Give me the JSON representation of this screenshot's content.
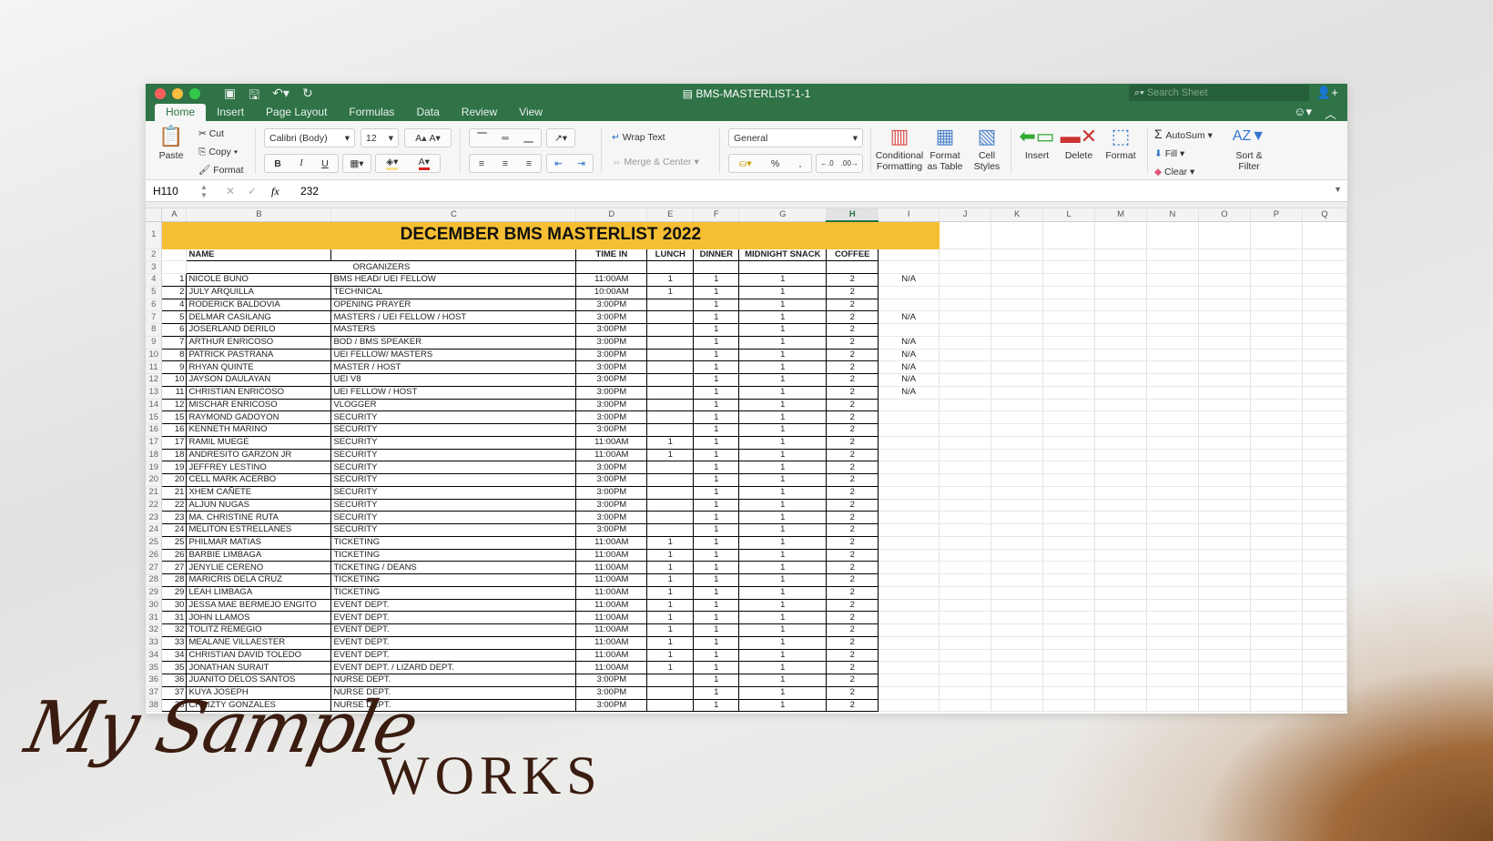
{
  "window": {
    "title": "BMS-MASTERLIST-1-1",
    "search_placeholder": "Search Sheet"
  },
  "tabs": [
    "Home",
    "Insert",
    "Page Layout",
    "Formulas",
    "Data",
    "Review",
    "View"
  ],
  "ribbon": {
    "paste": "Paste",
    "cut": "Cut",
    "copy": "Copy",
    "format_painter": "Format",
    "font_name": "Calibri (Body)",
    "font_size": "12",
    "bold": "B",
    "italic": "I",
    "underline": "U",
    "wrap_text": "Wrap Text",
    "merge_center": "Merge & Center",
    "number_format": "General",
    "percent": "%",
    "conditional_formatting": "Conditional Formatting",
    "format_as_table": "Format as Table",
    "cell_styles": "Cell Styles",
    "insert": "Insert",
    "delete": "Delete",
    "format": "Format",
    "autosum": "AutoSum",
    "fill": "Fill",
    "clear": "Clear",
    "sort_filter": "Sort & Filter"
  },
  "formula_bar": {
    "cell_ref": "H110",
    "fx": "fx",
    "value": "232"
  },
  "columns": [
    "A",
    "B",
    "C",
    "D",
    "E",
    "F",
    "G",
    "H",
    "I",
    "J",
    "K",
    "L",
    "M",
    "N",
    "O",
    "P",
    "Q"
  ],
  "selected_column": "H",
  "sheet": {
    "title": "DECEMBER BMS MASTERLIST 2022",
    "headers": {
      "name": "NAME",
      "time_in": "TIME IN",
      "lunch": "LUNCH",
      "dinner": "DINNER",
      "snack": "MIDNIGHT SNACK",
      "coffee": "COFFEE"
    },
    "section": "ORGANIZERS",
    "rows": [
      [
        "1",
        "NICOLE BUNO",
        "BMS HEAD/ UEI FELLOW",
        "11:00AM",
        "1",
        "1",
        "1",
        "2",
        "N/A"
      ],
      [
        "2",
        "JULY ARQUILLA",
        "TECHNICAL",
        "10:00AM",
        "1",
        "1",
        "1",
        "2",
        ""
      ],
      [
        "4",
        "RODERICK BALDOVIA",
        "OPENING PRAYER",
        "3:00PM",
        "",
        "1",
        "1",
        "2",
        ""
      ],
      [
        "5",
        "DELMAR CASILANG",
        "MASTERS / UEI FELLOW / HOST",
        "3:00PM",
        "",
        "1",
        "1",
        "2",
        "N/A"
      ],
      [
        "6",
        "JOSERLAND DERILO",
        "MASTERS",
        "3:00PM",
        "",
        "1",
        "1",
        "2",
        ""
      ],
      [
        "7",
        "ARTHUR ENRICOSO",
        "BOD / BMS SPEAKER",
        "3:00PM",
        "",
        "1",
        "1",
        "2",
        "N/A"
      ],
      [
        "8",
        "PATRICK PASTRANA",
        "UEI FELLOW/ MASTERS",
        "3:00PM",
        "",
        "1",
        "1",
        "2",
        "N/A"
      ],
      [
        "9",
        "RHYAN QUINTE",
        "MASTER / HOST",
        "3:00PM",
        "",
        "1",
        "1",
        "2",
        "N/A"
      ],
      [
        "10",
        "JAYSON DAULAYAN",
        "UEI V8",
        "3:00PM",
        "",
        "1",
        "1",
        "2",
        "N/A"
      ],
      [
        "11",
        "CHRISTIAN ENRICOSO",
        "UEI FELLOW / HOST",
        "3:00PM",
        "",
        "1",
        "1",
        "2",
        "N/A"
      ],
      [
        "12",
        "MISCHAR ENRICOSO",
        "VLOGGER",
        "3:00PM",
        "",
        "1",
        "1",
        "2",
        ""
      ],
      [
        "15",
        "RAYMOND GADOYON",
        "SECURITY",
        "3:00PM",
        "",
        "1",
        "1",
        "2",
        ""
      ],
      [
        "16",
        "KENNETH MARINO",
        "SECURITY",
        "3:00PM",
        "",
        "1",
        "1",
        "2",
        ""
      ],
      [
        "17",
        "RAMIL MUEGE",
        "SECURITY",
        "11:00AM",
        "1",
        "1",
        "1",
        "2",
        ""
      ],
      [
        "18",
        "ANDRESITO GARZON JR",
        "SECURITY",
        "11:00AM",
        "1",
        "1",
        "1",
        "2",
        ""
      ],
      [
        "19",
        "JEFFREY LESTINO",
        "SECURITY",
        "3:00PM",
        "",
        "1",
        "1",
        "2",
        ""
      ],
      [
        "20",
        "CELL MARK ACERBO",
        "SECURITY",
        "3:00PM",
        "",
        "1",
        "1",
        "2",
        ""
      ],
      [
        "21",
        "XHEM CAÑETE",
        "SECURITY",
        "3:00PM",
        "",
        "1",
        "1",
        "2",
        ""
      ],
      [
        "22",
        "ALJUN NUGAS",
        "SECURITY",
        "3:00PM",
        "",
        "1",
        "1",
        "2",
        ""
      ],
      [
        "23",
        "MA. CHRISTINE RUTA",
        "SECURITY",
        "3:00PM",
        "",
        "1",
        "1",
        "2",
        ""
      ],
      [
        "24",
        "MELITON ESTRELLANES",
        "SECURITY",
        "3:00PM",
        "",
        "1",
        "1",
        "2",
        ""
      ],
      [
        "25",
        "PHILMAR MATIAS",
        "TICKETING",
        "11:00AM",
        "1",
        "1",
        "1",
        "2",
        ""
      ],
      [
        "26",
        "BARBIE LIMBAGA",
        "TICKETING",
        "11:00AM",
        "1",
        "1",
        "1",
        "2",
        ""
      ],
      [
        "27",
        "JENYLIE CERENO",
        "TICKETING / DEANS",
        "11:00AM",
        "1",
        "1",
        "1",
        "2",
        ""
      ],
      [
        "28",
        "MARICRIS DELA CRUZ",
        "TICKETING",
        "11:00AM",
        "1",
        "1",
        "1",
        "2",
        ""
      ],
      [
        "29",
        "LEAH LIMBAGA",
        "TICKETING",
        "11:00AM",
        "1",
        "1",
        "1",
        "2",
        ""
      ],
      [
        "30",
        "JESSA MAE BERMEJO ENGITO",
        "EVENT DEPT.",
        "11:00AM",
        "1",
        "1",
        "1",
        "2",
        ""
      ],
      [
        "31",
        "JOHN LLAMOS",
        "EVENT DEPT.",
        "11:00AM",
        "1",
        "1",
        "1",
        "2",
        ""
      ],
      [
        "32",
        "TOLITZ REMEGIO",
        "EVENT DEPT.",
        "11:00AM",
        "1",
        "1",
        "1",
        "2",
        ""
      ],
      [
        "33",
        "MEALANE VILLAESTER",
        "EVENT DEPT.",
        "11:00AM",
        "1",
        "1",
        "1",
        "2",
        ""
      ],
      [
        "34",
        "CHRISTIAN DAVID TOLEDO",
        "EVENT DEPT.",
        "11:00AM",
        "1",
        "1",
        "1",
        "2",
        ""
      ],
      [
        "35",
        "JONATHAN SURAIT",
        "EVENT DEPT. / LIZARD DEPT.",
        "11:00AM",
        "1",
        "1",
        "1",
        "2",
        ""
      ],
      [
        "36",
        "JUANITO DELOS SANTOS",
        "NURSE DEPT.",
        "3:00PM",
        "",
        "1",
        "1",
        "2",
        ""
      ],
      [
        "37",
        "KUYA JOSEPH",
        "NURSE DEPT.",
        "3:00PM",
        "",
        "1",
        "1",
        "2",
        ""
      ],
      [
        "38",
        "CHRIZTY GONZALES",
        "NURSE DEPT.",
        "3:00PM",
        "",
        "1",
        "1",
        "2",
        ""
      ]
    ]
  },
  "watermark": {
    "script": "My Sample",
    "serif": "WORKS"
  }
}
